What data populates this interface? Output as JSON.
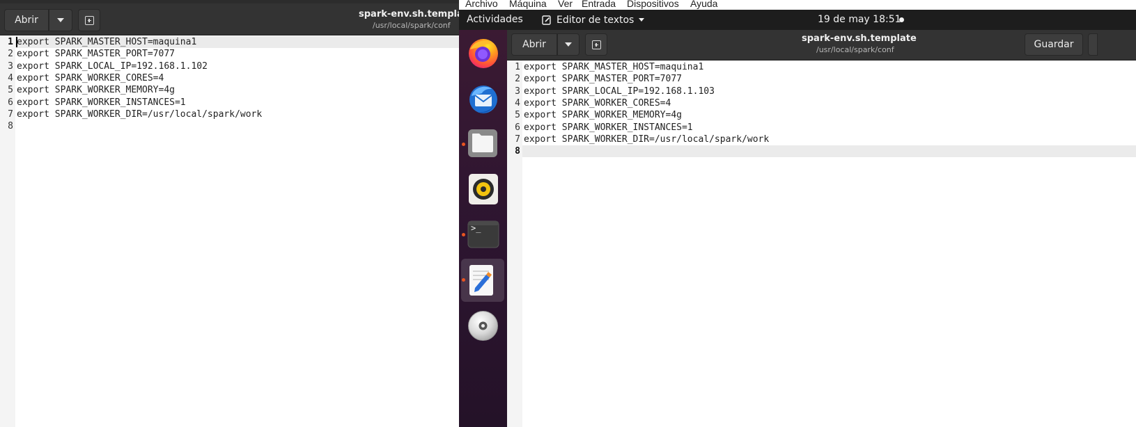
{
  "left_window": {
    "open_label": "Abrir",
    "title": "spark-env.sh.template",
    "subtitle": "/usr/local/spark/conf",
    "lines": [
      {
        "num": "1",
        "text": "export SPARK_MASTER_HOST=maquina1"
      },
      {
        "num": "2",
        "text": "export SPARK_MASTER_PORT=7077"
      },
      {
        "num": "3",
        "text": "export SPARK_LOCAL_IP=192.168.1.102"
      },
      {
        "num": "4",
        "text": "export SPARK_WORKER_CORES=4"
      },
      {
        "num": "5",
        "text": "export SPARK_WORKER_MEMORY=4g"
      },
      {
        "num": "6",
        "text": "export SPARK_WORKER_INSTANCES=1"
      },
      {
        "num": "7",
        "text": "export SPARK_WORKER_DIR=/usr/local/spark/work"
      },
      {
        "num": "8",
        "text": ""
      }
    ]
  },
  "vm_menu": {
    "items": [
      "Archivo",
      "Máquina",
      "Ver",
      "Entrada",
      "Dispositivos",
      "Ayuda"
    ]
  },
  "topbar": {
    "activities": "Actividades",
    "app_name": "Editor de textos",
    "datetime": "19 de may  18:51"
  },
  "dock": {
    "items": [
      {
        "name": "firefox-icon",
        "running": false
      },
      {
        "name": "thunderbird-icon",
        "running": false
      },
      {
        "name": "files-icon",
        "running": true
      },
      {
        "name": "rhythmbox-icon",
        "running": false
      },
      {
        "name": "terminal-icon",
        "running": true
      },
      {
        "name": "text-editor-icon",
        "running": true,
        "active": true
      },
      {
        "name": "disc-icon",
        "running": false
      }
    ],
    "terminal_prompt": ">_"
  },
  "right_window": {
    "open_label": "Abrir",
    "save_label": "Guardar",
    "title": "spark-env.sh.template",
    "subtitle": "/usr/local/spark/conf",
    "lines": [
      {
        "num": "1",
        "text": "export SPARK_MASTER_HOST=maquina1"
      },
      {
        "num": "2",
        "text": "export SPARK_MASTER_PORT=7077"
      },
      {
        "num": "3",
        "text": "export SPARK_LOCAL_IP=192.168.1.103"
      },
      {
        "num": "4",
        "text": "export SPARK_WORKER_CORES=4"
      },
      {
        "num": "5",
        "text": "export SPARK_WORKER_MEMORY=4g"
      },
      {
        "num": "6",
        "text": "export SPARK_WORKER_INSTANCES=1"
      },
      {
        "num": "7",
        "text": "export SPARK_WORKER_DIR=/usr/local/spark/work"
      },
      {
        "num": "8",
        "text": ""
      }
    ]
  },
  "colors": {
    "headerbar": "#333333",
    "topbar": "#1d1d1d",
    "dock": "#2d1530",
    "running_indicator": "#e95420"
  }
}
